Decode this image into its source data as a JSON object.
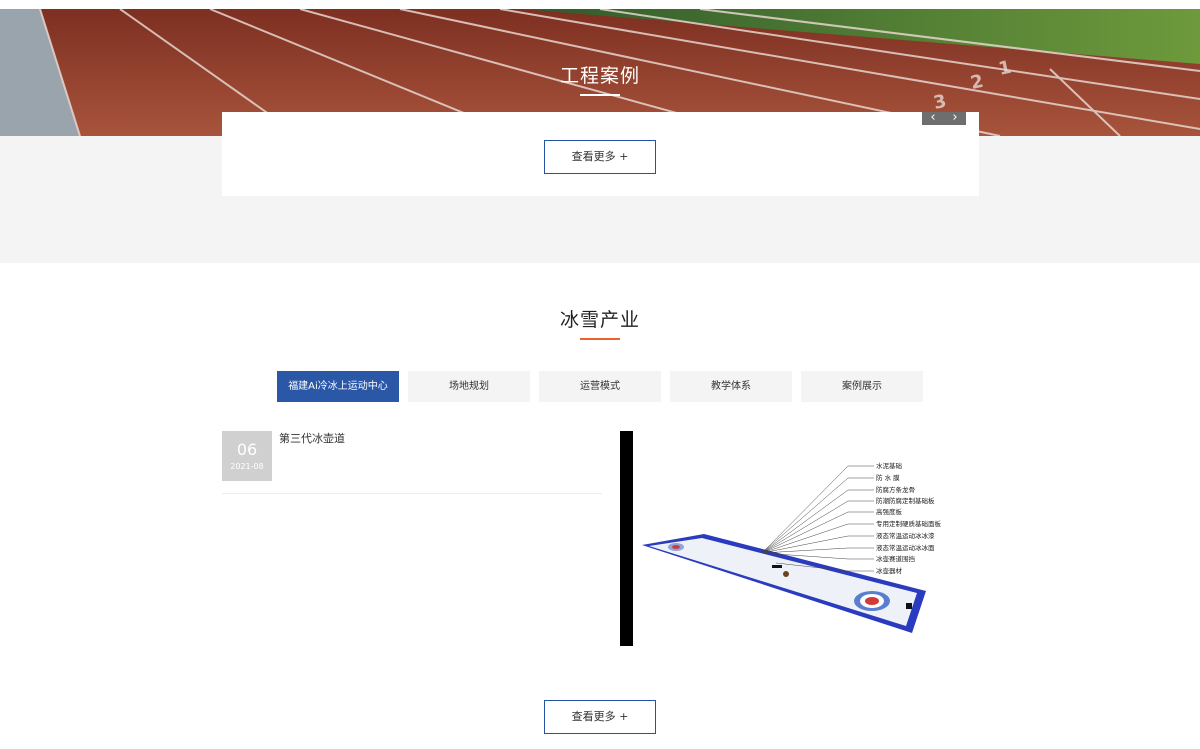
{
  "cases_section": {
    "title": "工程案例",
    "prev_arrow": "‹",
    "next_arrow": "›",
    "more_button": "查看更多 +"
  },
  "ice_snow_section": {
    "title": "冰雪产业",
    "tabs": [
      {
        "label": "福建Ai冷冰上运动中心",
        "active": true
      },
      {
        "label": "场地规划",
        "active": false
      },
      {
        "label": "运营模式",
        "active": false
      },
      {
        "label": "教学体系",
        "active": false
      },
      {
        "label": "案例展示",
        "active": false
      }
    ],
    "news": [
      {
        "day": "06",
        "year_month": "2021-08",
        "title": "第三代冰壶道"
      }
    ],
    "diagram_labels": [
      "水泥基础",
      "防 水 膜",
      "防腐方条龙骨",
      "防潮防腐定制基础板",
      "高强度板",
      "专用定制硬质基础面板",
      "液态常温运动冰冰漆",
      "液态常温运动冰冰面",
      "冰壶赛道围挡",
      "冰壶器材"
    ],
    "more_button": "查看更多 +"
  },
  "colors": {
    "accent_blue": "#2a57a6",
    "accent_orange": "#e8632c",
    "track_red": "#8e3a28"
  }
}
